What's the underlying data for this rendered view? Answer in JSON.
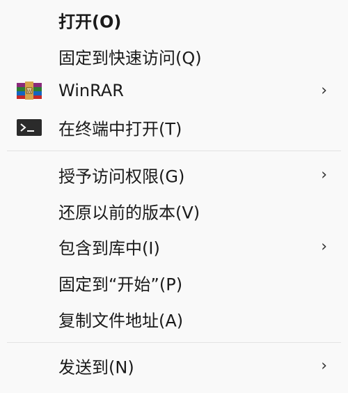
{
  "menu": {
    "items": [
      {
        "label": "打开(O)"
      },
      {
        "label": "固定到快速访问(Q)"
      },
      {
        "label": "WinRAR",
        "icon": "winrar-icon",
        "submenu": "›"
      },
      {
        "label": "在终端中打开(T)",
        "icon": "terminal-icon"
      },
      {
        "label": "授予访问权限(G)",
        "submenu": "›"
      },
      {
        "label": "还原以前的版本(V)"
      },
      {
        "label": "包含到库中(I)",
        "submenu": "›"
      },
      {
        "label": "固定到“开始”(P)"
      },
      {
        "label": "复制文件地址(A)"
      },
      {
        "label": "发送到(N)",
        "submenu": "›"
      }
    ]
  }
}
